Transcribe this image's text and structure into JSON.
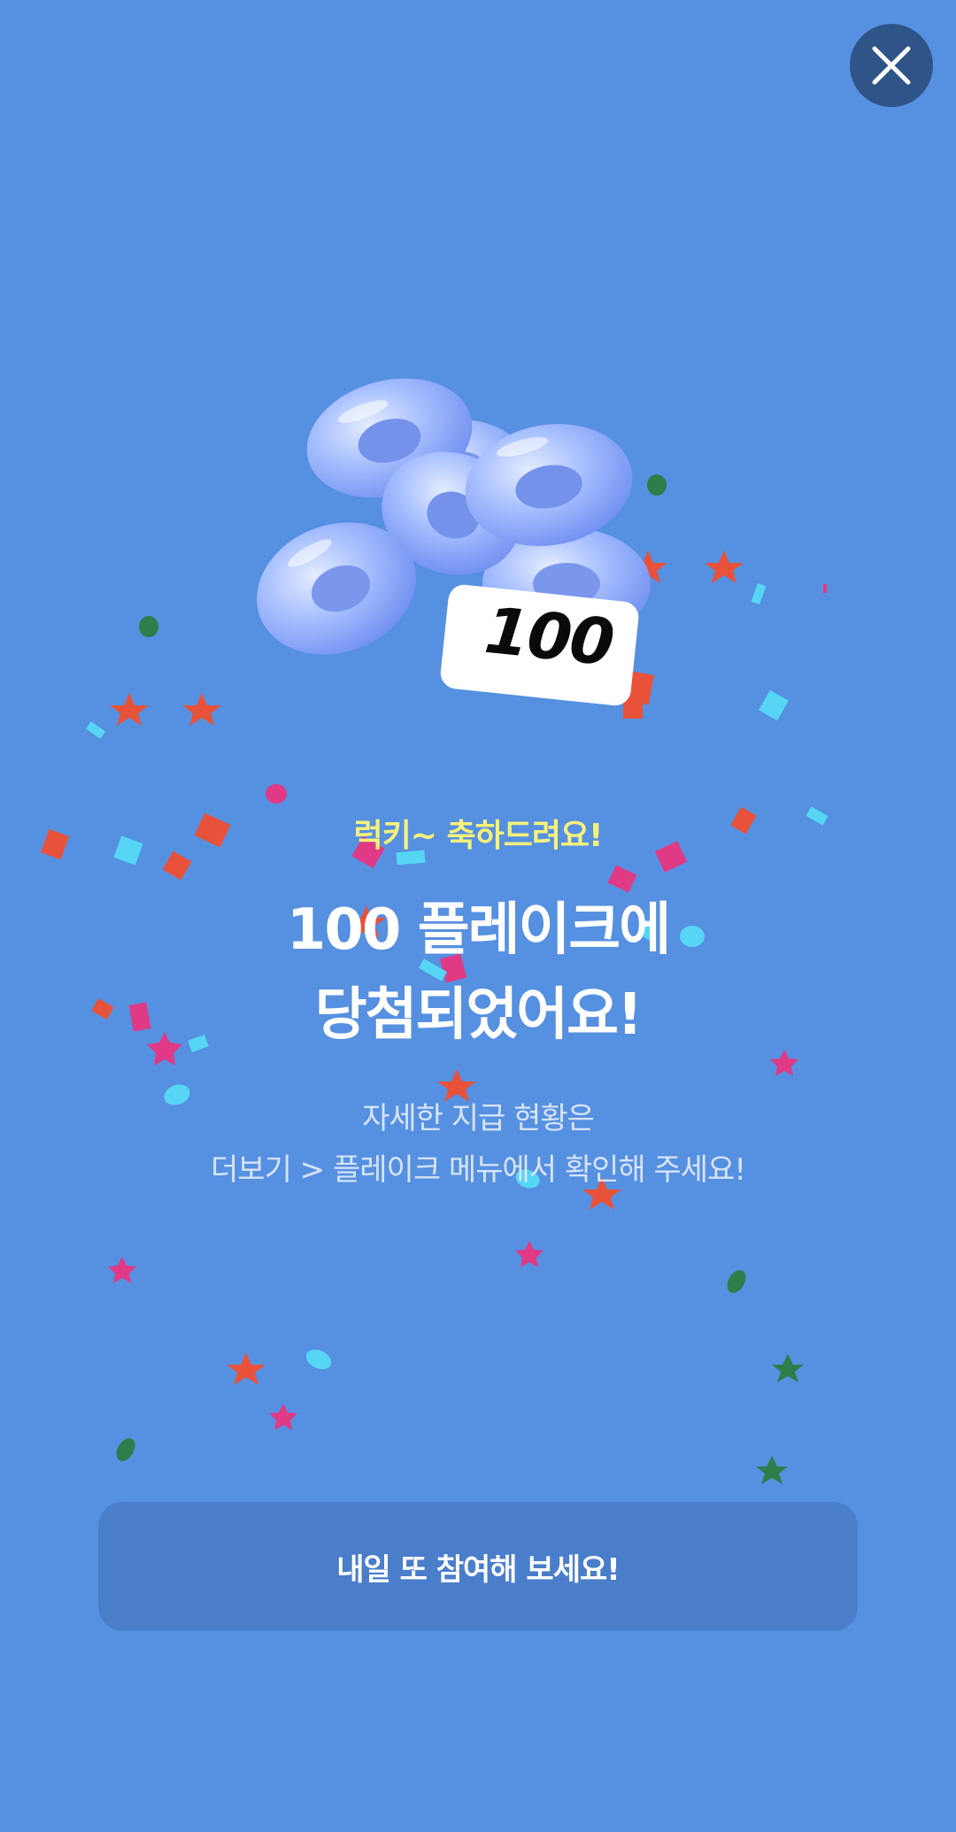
{
  "close_button": {
    "icon": "close-icon"
  },
  "hero": {
    "badge_value": "100",
    "icon": "donut-coins-illustration"
  },
  "message": {
    "lucky_text": "럭키~ 축하드려요!",
    "headline_line1": "100 플레이크에",
    "headline_line2": "당첨되었어요!",
    "description_line1": "자세한 지급 현황은",
    "description_line2": "더보기 > 플레이크 메뉴에서 확인해 주세요!"
  },
  "cta": {
    "label": "내일 또 참여해 보세요!"
  },
  "colors": {
    "background": "#5690e1",
    "close_button": "#2f5487",
    "lucky_text": "#f5f17a",
    "cta_background": "#4a7ecb"
  }
}
